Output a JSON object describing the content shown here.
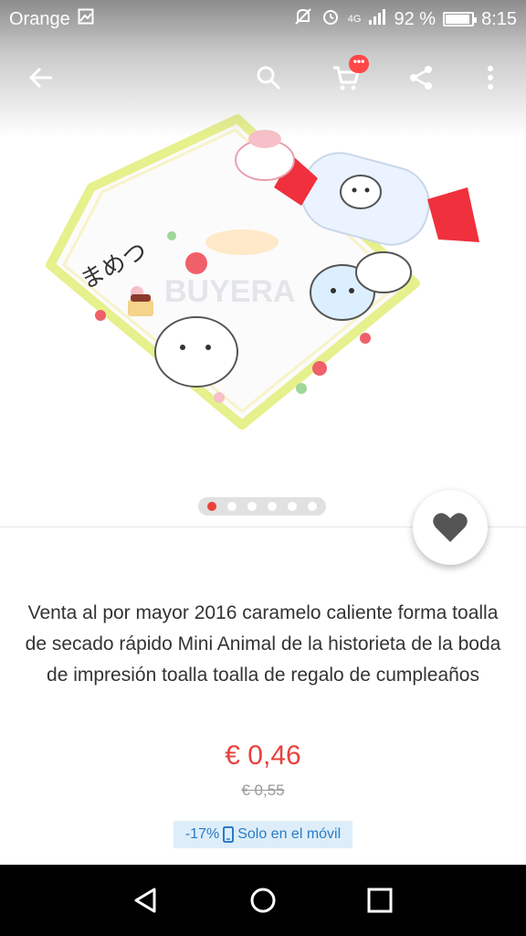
{
  "status_bar": {
    "carrier": "Orange",
    "network": "4G",
    "battery": "92 %",
    "time": "8:15"
  },
  "toolbar": {
    "cart_badge": "•••"
  },
  "gallery": {
    "watermark": "BUYERA",
    "image_text": "まめつ",
    "dots": 6,
    "active_index": 0
  },
  "product": {
    "title": "Venta al por mayor 2016 caramelo caliente forma toalla de secado rápido Mini Animal de la historieta de la boda de impresión toalla toalla de regalo de cumpleaños",
    "price": "€ 0,46",
    "original_price": "€ 0,55",
    "discount": "-17%",
    "mobile_only": "Solo en el móvil"
  },
  "colors": {
    "accent": "#e8413b",
    "promo_bg": "#ddeefa",
    "promo_text": "#2a7bc5"
  }
}
